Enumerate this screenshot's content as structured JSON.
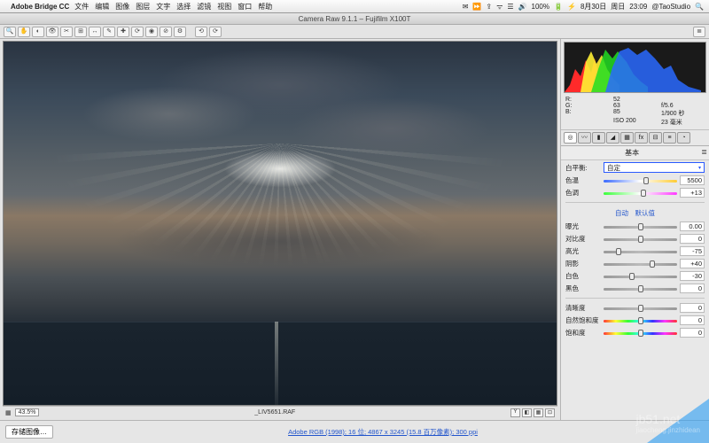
{
  "menubar": {
    "apple_icon": "",
    "app_name": "Adobe Bridge CC",
    "items": [
      "文件",
      "编辑",
      "图像",
      "图层",
      "文字",
      "选择",
      "滤镜",
      "视图",
      "窗口",
      "帮助"
    ],
    "right": {
      "icons": [
        "✉",
        "⏩",
        "⇪",
        "ᯤ",
        "☰",
        "🔊",
        "🔋"
      ],
      "battery": "100%",
      "charge_icon": "⚡",
      "date": "8月30日",
      "day": "周日",
      "time": "23:09",
      "user": "@TaoStudio",
      "search_icon": "🔍"
    }
  },
  "titlebar": {
    "text": "Camera Raw 9.1.1 – Fujifilm X100T"
  },
  "toolbar": {
    "tools": [
      "🔍",
      "✋",
      "◐",
      "👁",
      "✂",
      "⊞",
      "↔",
      "✎",
      "✚",
      "⟳",
      "◉",
      "⊘",
      "⚙"
    ],
    "rotate": [
      "⟲",
      "⟳"
    ],
    "menu_icon": "≣"
  },
  "viewer": {
    "zoom": "43.5%",
    "filename": "_LIV5651.RAF",
    "bottom_icons": [
      "Y",
      "◧",
      "▦",
      "⊡"
    ],
    "grid_icon": "▦"
  },
  "info": {
    "r_label": "R:",
    "r": "52",
    "g_label": "G:",
    "g": "63",
    "b_label": "B:",
    "b": "85",
    "aperture": "f/5.6",
    "shutter": "1/900 秒",
    "iso": "ISO 200",
    "focal": "23 毫米"
  },
  "tabs": [
    "◎",
    "〰",
    "▮",
    "◢",
    "▦",
    "fx",
    "⊟",
    "≡",
    "◔"
  ],
  "section": {
    "title": "基本",
    "menu": "≣"
  },
  "wb": {
    "label": "白平衡:",
    "value": "自定"
  },
  "sliders": {
    "temp": {
      "label": "色温",
      "value": "5500",
      "pos": 58
    },
    "tint": {
      "label": "色调",
      "value": "+13",
      "pos": 54
    },
    "autodef": {
      "auto": "自动",
      "def": "默认值"
    },
    "exposure": {
      "label": "曝光",
      "value": "0.00",
      "pos": 50
    },
    "contrast": {
      "label": "对比度",
      "value": "0",
      "pos": 50
    },
    "highlight": {
      "label": "高光",
      "value": "-75",
      "pos": 20
    },
    "shadow": {
      "label": "阴影",
      "value": "+40",
      "pos": 66
    },
    "white": {
      "label": "白色",
      "value": "-30",
      "pos": 38
    },
    "black": {
      "label": "黑色",
      "value": "0",
      "pos": 50
    },
    "clarity": {
      "label": "清晰度",
      "value": "0",
      "pos": 50
    },
    "vibrance": {
      "label": "自然饱和度",
      "value": "0",
      "pos": 50
    },
    "sat": {
      "label": "饱和度",
      "value": "0",
      "pos": 50
    }
  },
  "footer": {
    "save": "存储图像…",
    "link": "Adobe RGB (1998); 16 位; 4867 x 3245 (15.8 百万像素); 300 ppi"
  },
  "watermark": {
    "site": "jb51.net",
    "sub": "jiaocheng.jinzhidean"
  }
}
